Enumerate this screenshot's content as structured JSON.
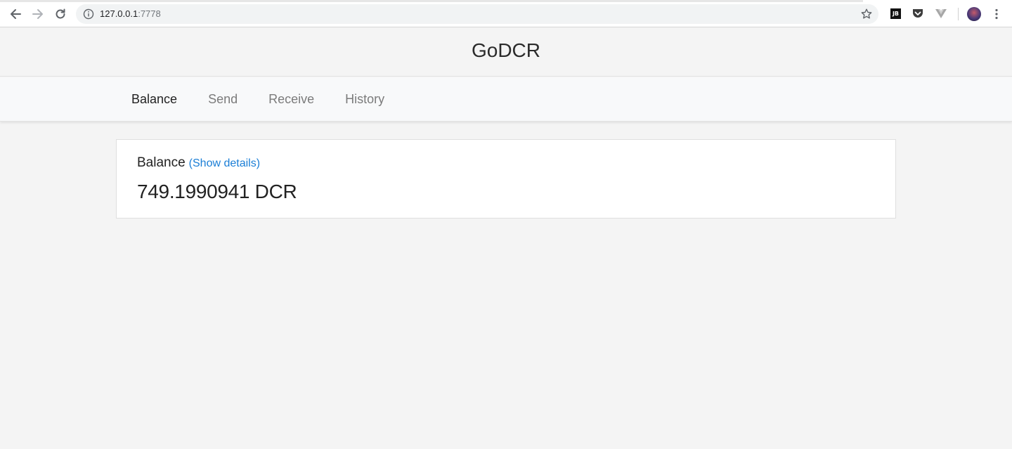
{
  "browser": {
    "url_host": "127.0.0.1",
    "url_port": ":7778",
    "jb_extension_text": "JB"
  },
  "app": {
    "title": "GoDCR"
  },
  "tabs": [
    {
      "label": "Balance",
      "active": true
    },
    {
      "label": "Send",
      "active": false
    },
    {
      "label": "Receive",
      "active": false
    },
    {
      "label": "History",
      "active": false
    }
  ],
  "balance_card": {
    "title": "Balance",
    "details_link": "(Show details)",
    "amount": "749.1990941 DCR"
  },
  "icons": {
    "back": "arrow-left-icon",
    "forward": "arrow-right-icon",
    "reload": "reload-icon",
    "site_info": "info-icon",
    "bookmark": "star-icon",
    "pocket": "pocket-icon",
    "vue_devtools": "vue-icon",
    "menu": "kebab-menu-icon"
  },
  "colors": {
    "link": "#1a7ed6",
    "page_bg": "#f4f4f4",
    "card_bg": "#ffffff",
    "inactive_tab": "#7b7b7b"
  }
}
